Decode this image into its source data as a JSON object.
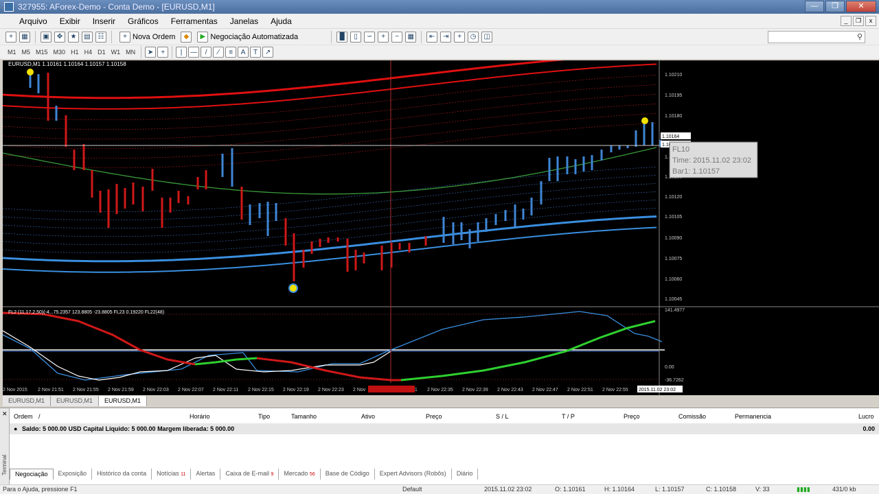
{
  "window": {
    "title": "327955: AForex-Demo - Conta Demo - [EURUSD,M1]"
  },
  "menu": [
    "Arquivo",
    "Exibir",
    "Inserir",
    "Gráficos",
    "Ferramentas",
    "Janelas",
    "Ajuda"
  ],
  "toolbar": {
    "new_order": "Nova Ordem",
    "auto_trading": "Negociação Automatizada"
  },
  "timeframes": [
    "M1",
    "M5",
    "M15",
    "M30",
    "H1",
    "H4",
    "D1",
    "W1",
    "MN"
  ],
  "chart": {
    "header": "EURUSD,M1  1.10161 1.10164 1.10157 1.10158",
    "price_ticks": [
      "1.10210",
      "1.10195",
      "1.10180",
      "1.10164",
      "1.10158",
      "1.10150",
      "1.10135",
      "1.10120",
      "1.10105",
      "1.10090",
      "1.10075",
      "1.10060",
      "1.10045"
    ],
    "time_ticks": [
      "2 Nov 2015",
      "2 Nov 21:51",
      "2 Nov 21:55",
      "2 Nov 21:59",
      "2 Nov 22:03",
      "2 Nov 22:07",
      "2 Nov 22:11",
      "2 Nov 22:15",
      "2 Nov 22:19",
      "2 Nov 22:23",
      "2 Nov",
      "31",
      "2 Nov 22:35",
      "2 Nov 22:39",
      "2 Nov 22:43",
      "2 Nov 22:47",
      "2 Nov 22:51",
      "2 Nov 22:55"
    ],
    "crosshair_time_label": "2015.11.02 23:02",
    "tooltip": {
      "name": "FL10",
      "time": "Time: 2015.11.02 23:02",
      "bar": "Bar1: 1.10157"
    },
    "indicator_header": "FL2 (11,17,2,50)(-4...75.2357 123.8805 -23.8805  FL23 0.19220  FL22(48)",
    "indicator_ticks": [
      "141.4977",
      "0.00",
      "-36.7262"
    ],
    "colors": {
      "up": "#3f86d6",
      "down": "#d01818",
      "upper_band": "#e01010",
      "lower_band": "#3a8fe0",
      "ma": "#3a9a3a"
    }
  },
  "chart_tabs": [
    "EURUSD,M1",
    "EURUSD,M1",
    "EURUSD,M1"
  ],
  "terminal": {
    "columns": [
      "Ordem",
      "/",
      "Horário",
      "Tipo",
      "Tamanho",
      "Ativo",
      "Preço",
      "S / L",
      "T / P",
      "Preço",
      "Comissão",
      "Permanencia",
      "Lucro"
    ],
    "balance_text": "Saldo: 5 000.00 USD  Capital Líquido: 5 000.00  Margem liberada: 5 000.00",
    "balance_value": "0.00",
    "side_label": "Terminal",
    "tabs": [
      {
        "label": "Negociação",
        "count": ""
      },
      {
        "label": "Exposição",
        "count": ""
      },
      {
        "label": "Histórico da conta",
        "count": ""
      },
      {
        "label": "Notícias",
        "count": "11"
      },
      {
        "label": "Alertas",
        "count": ""
      },
      {
        "label": "Caixa de E-mail",
        "count": "9"
      },
      {
        "label": "Mercado",
        "count": "56"
      },
      {
        "label": "Base de Código",
        "count": ""
      },
      {
        "label": "Expert Advisors (Robôs)",
        "count": ""
      },
      {
        "label": "Diário",
        "count": ""
      }
    ]
  },
  "status": {
    "help": "Para o Ajuda, pressione F1",
    "profile": "Default",
    "time": "2015.11.02 23:02",
    "open": "O: 1.10161",
    "high": "H: 1.10164",
    "low": "L: 1.10157",
    "close": "C: 1.10158",
    "volume": "V: 33",
    "traffic": "431/0 kb"
  }
}
